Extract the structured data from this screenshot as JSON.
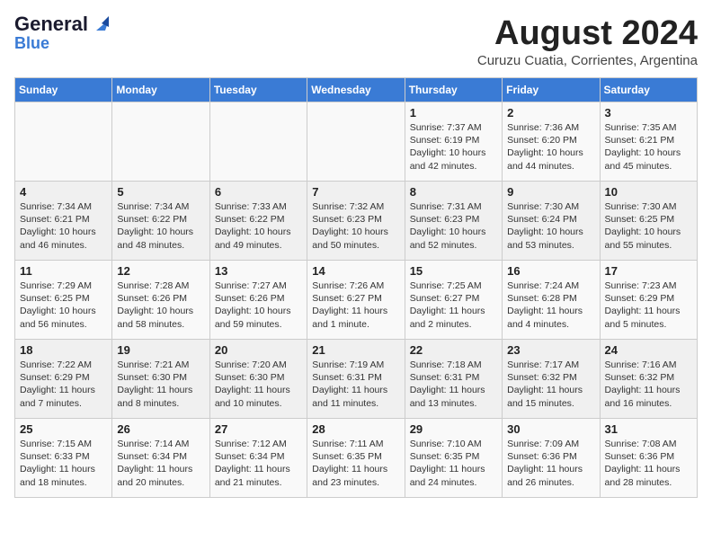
{
  "header": {
    "logo_general": "General",
    "logo_blue": "Blue",
    "month": "August 2024",
    "location": "Curuzu Cuatia, Corrientes, Argentina"
  },
  "days_of_week": [
    "Sunday",
    "Monday",
    "Tuesday",
    "Wednesday",
    "Thursday",
    "Friday",
    "Saturday"
  ],
  "weeks": [
    [
      {
        "day": "",
        "info": ""
      },
      {
        "day": "",
        "info": ""
      },
      {
        "day": "",
        "info": ""
      },
      {
        "day": "",
        "info": ""
      },
      {
        "day": "1",
        "info": "Sunrise: 7:37 AM\nSunset: 6:19 PM\nDaylight: 10 hours\nand 42 minutes."
      },
      {
        "day": "2",
        "info": "Sunrise: 7:36 AM\nSunset: 6:20 PM\nDaylight: 10 hours\nand 44 minutes."
      },
      {
        "day": "3",
        "info": "Sunrise: 7:35 AM\nSunset: 6:21 PM\nDaylight: 10 hours\nand 45 minutes."
      }
    ],
    [
      {
        "day": "4",
        "info": "Sunrise: 7:34 AM\nSunset: 6:21 PM\nDaylight: 10 hours\nand 46 minutes."
      },
      {
        "day": "5",
        "info": "Sunrise: 7:34 AM\nSunset: 6:22 PM\nDaylight: 10 hours\nand 48 minutes."
      },
      {
        "day": "6",
        "info": "Sunrise: 7:33 AM\nSunset: 6:22 PM\nDaylight: 10 hours\nand 49 minutes."
      },
      {
        "day": "7",
        "info": "Sunrise: 7:32 AM\nSunset: 6:23 PM\nDaylight: 10 hours\nand 50 minutes."
      },
      {
        "day": "8",
        "info": "Sunrise: 7:31 AM\nSunset: 6:23 PM\nDaylight: 10 hours\nand 52 minutes."
      },
      {
        "day": "9",
        "info": "Sunrise: 7:30 AM\nSunset: 6:24 PM\nDaylight: 10 hours\nand 53 minutes."
      },
      {
        "day": "10",
        "info": "Sunrise: 7:30 AM\nSunset: 6:25 PM\nDaylight: 10 hours\nand 55 minutes."
      }
    ],
    [
      {
        "day": "11",
        "info": "Sunrise: 7:29 AM\nSunset: 6:25 PM\nDaylight: 10 hours\nand 56 minutes."
      },
      {
        "day": "12",
        "info": "Sunrise: 7:28 AM\nSunset: 6:26 PM\nDaylight: 10 hours\nand 58 minutes."
      },
      {
        "day": "13",
        "info": "Sunrise: 7:27 AM\nSunset: 6:26 PM\nDaylight: 10 hours\nand 59 minutes."
      },
      {
        "day": "14",
        "info": "Sunrise: 7:26 AM\nSunset: 6:27 PM\nDaylight: 11 hours\nand 1 minute."
      },
      {
        "day": "15",
        "info": "Sunrise: 7:25 AM\nSunset: 6:27 PM\nDaylight: 11 hours\nand 2 minutes."
      },
      {
        "day": "16",
        "info": "Sunrise: 7:24 AM\nSunset: 6:28 PM\nDaylight: 11 hours\nand 4 minutes."
      },
      {
        "day": "17",
        "info": "Sunrise: 7:23 AM\nSunset: 6:29 PM\nDaylight: 11 hours\nand 5 minutes."
      }
    ],
    [
      {
        "day": "18",
        "info": "Sunrise: 7:22 AM\nSunset: 6:29 PM\nDaylight: 11 hours\nand 7 minutes."
      },
      {
        "day": "19",
        "info": "Sunrise: 7:21 AM\nSunset: 6:30 PM\nDaylight: 11 hours\nand 8 minutes."
      },
      {
        "day": "20",
        "info": "Sunrise: 7:20 AM\nSunset: 6:30 PM\nDaylight: 11 hours\nand 10 minutes."
      },
      {
        "day": "21",
        "info": "Sunrise: 7:19 AM\nSunset: 6:31 PM\nDaylight: 11 hours\nand 11 minutes."
      },
      {
        "day": "22",
        "info": "Sunrise: 7:18 AM\nSunset: 6:31 PM\nDaylight: 11 hours\nand 13 minutes."
      },
      {
        "day": "23",
        "info": "Sunrise: 7:17 AM\nSunset: 6:32 PM\nDaylight: 11 hours\nand 15 minutes."
      },
      {
        "day": "24",
        "info": "Sunrise: 7:16 AM\nSunset: 6:32 PM\nDaylight: 11 hours\nand 16 minutes."
      }
    ],
    [
      {
        "day": "25",
        "info": "Sunrise: 7:15 AM\nSunset: 6:33 PM\nDaylight: 11 hours\nand 18 minutes."
      },
      {
        "day": "26",
        "info": "Sunrise: 7:14 AM\nSunset: 6:34 PM\nDaylight: 11 hours\nand 20 minutes."
      },
      {
        "day": "27",
        "info": "Sunrise: 7:12 AM\nSunset: 6:34 PM\nDaylight: 11 hours\nand 21 minutes."
      },
      {
        "day": "28",
        "info": "Sunrise: 7:11 AM\nSunset: 6:35 PM\nDaylight: 11 hours\nand 23 minutes."
      },
      {
        "day": "29",
        "info": "Sunrise: 7:10 AM\nSunset: 6:35 PM\nDaylight: 11 hours\nand 24 minutes."
      },
      {
        "day": "30",
        "info": "Sunrise: 7:09 AM\nSunset: 6:36 PM\nDaylight: 11 hours\nand 26 minutes."
      },
      {
        "day": "31",
        "info": "Sunrise: 7:08 AM\nSunset: 6:36 PM\nDaylight: 11 hours\nand 28 minutes."
      }
    ]
  ]
}
